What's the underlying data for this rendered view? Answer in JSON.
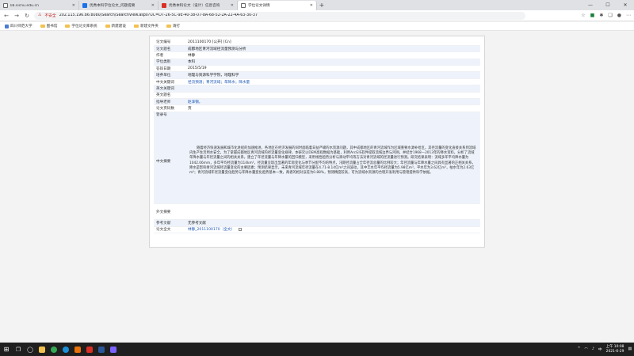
{
  "browser": {
    "tabs": [
      {
        "label": "lib.sicnu.edu.cn",
        "favicon": "doc",
        "active": false
      },
      {
        "label": "优秀本科学位论文_问题提要",
        "favicon": "blue",
        "active": false
      },
      {
        "label": "优秀本科论文（设计）信息咨询",
        "favicon": "red",
        "active": false
      },
      {
        "label": "学位论文详情",
        "favicon": "doc",
        "active": true
      }
    ],
    "address": {
      "security_label": "不安全",
      "url": "202.115.196.86:8080/Search/SearchView.aspx?UC=D7-26-5C-9E-40-38-07-8A-68-52-2A-22-4A-63-30-37"
    },
    "bookmarks": [
      {
        "label": "四川师范大学",
        "icon": "site"
      },
      {
        "label": "图书馆",
        "icon": "folder"
      },
      {
        "label": "学位论文库系统",
        "icon": "folder"
      },
      {
        "label": "新建建设",
        "icon": "folder"
      },
      {
        "label": "新建文件夹",
        "icon": "folder"
      },
      {
        "label": "请打",
        "icon": "folder"
      }
    ]
  },
  "record": {
    "rows": [
      {
        "key": "论文编号",
        "value": "2011100170 [公开] [Cn]"
      },
      {
        "key": "论文题名",
        "value": "成都地区青河流域径流量预测与分析"
      },
      {
        "key": "作者",
        "value": "林静"
      },
      {
        "key": "学位类别",
        "value": "本科"
      },
      {
        "key": "答辩日期",
        "value": "2015/5/19"
      },
      {
        "key": "培养单位",
        "value": "地理与资源科学学院，地理科学"
      },
      {
        "key": "中文关键词",
        "value": "径流预测；青河流域；年降水；降水量",
        "link": true
      },
      {
        "key": "英文关键词",
        "value": ""
      },
      {
        "key": "英文题名",
        "value": ""
      },
      {
        "key": "指导老师",
        "value": "赵泽钢，",
        "link": true
      },
      {
        "key": "论文页码数",
        "value": "页"
      },
      {
        "key": "登录号",
        "value": ""
      }
    ],
    "abstract_label": "中文摘要",
    "abstract_text": "随着经济快速发展和城市化进程的加速推进，各地区在经济发展的同时面临着日益严峻的水资源问题，其中成都地区的青河流域作为区域重要水源补给区，其径流量的变化直接关系到流域内生产生活用水安全。为了掌握成都地区青河流域的径流量变化规律，本研究以DEM高程数据为基础，利用ArcGIS软件提取流域边界与河网，并结合1968—2013年的降水资料，分析了流域年降水量与年径流量之间的相关关系，建立了年径流量与年降水量的回归模型，采用线性趋势分析与滑动平均等方法对青河流域的径流量进行预测。研究结果表明：流域多年平均降水量为1042.06mm，多年平均径流量为114km³，径流量呈现出显著的年际变化与季节分配不均的特点，汛期径流量占全年径流总量的比例较大；年径流量与年降水量之间具有显著的正相关关系，降水是影响青河流域径流量变化的主要因素；预测结果显示，未来青河流域年径流量在4.71-8.14亿m³之间波动，其中丰水年平均径流量为5.98亿m³，平水年为3.62亿m³，枯水年为2.63亿m³；青河流域年径流量变化趋势与年降水量变化趋势基本一致，两者的相对误差为0.88%，预测精度较高，可为流域水资源的合理开发利用与管理提供科学依据。",
    "english_abstract_label": "外文摘要",
    "bottom_rows": [
      {
        "key": "参考文献",
        "value": "无参考文献"
      },
      {
        "key": "论文全文",
        "value": "林静_2011100170（全文）",
        "link": true
      }
    ]
  },
  "taskbar": {
    "time": "上午 10:08",
    "date": "2021-6-29",
    "lang": "中"
  }
}
